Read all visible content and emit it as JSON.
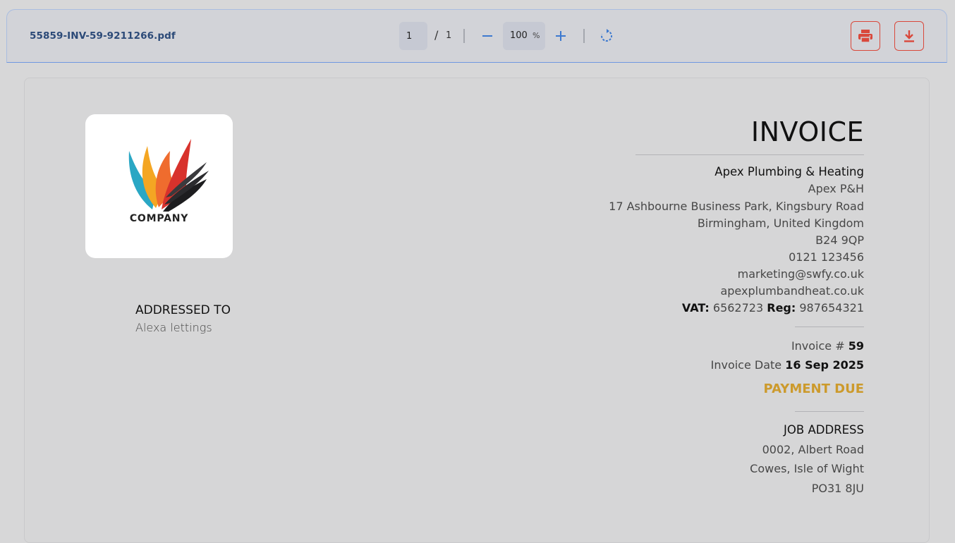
{
  "toolbar": {
    "filename": "55859-INV-59-9211266.pdf",
    "current_page": "1",
    "page_separator": "/",
    "total_pages": "1",
    "zoom_value": "100",
    "zoom_unit": "%",
    "accent_color": "#3d79cf",
    "action_color": "#d9483b",
    "icons": [
      "zoom-out-icon",
      "zoom-in-icon",
      "rotate-icon",
      "print-icon",
      "download-icon"
    ]
  },
  "invoice": {
    "logo_text": "COMPANY",
    "title": "INVOICE",
    "company": {
      "name": "Apex Plumbing & Heating",
      "short_name": "Apex P&H",
      "address_line1": "17 Ashbourne Business Park, Kingsbury Road",
      "address_line2": "Birmingham, United Kingdom",
      "postcode": "B24 9QP",
      "phone": "0121 123456",
      "email": "marketing@swfy.co.uk",
      "website": "apexplumbandheat.co.uk",
      "vat_label": "VAT:",
      "vat": "6562723",
      "reg_label": "Reg:",
      "reg": "987654321"
    },
    "invoice_number_label": "Invoice #",
    "invoice_number": "59",
    "invoice_date_label": "Invoice Date",
    "invoice_date": "16 Sep 2025",
    "status": "PAYMENT DUE",
    "status_color": "#cc9a2c",
    "addressed_to_label": "ADDRESSED TO",
    "addressed_to": "Alexa lettings",
    "job_address_label": "JOB ADDRESS",
    "job_address": {
      "line1": "0002, Albert Road",
      "line2": "Cowes, Isle of Wight",
      "postcode": "PO31 8JU"
    }
  }
}
